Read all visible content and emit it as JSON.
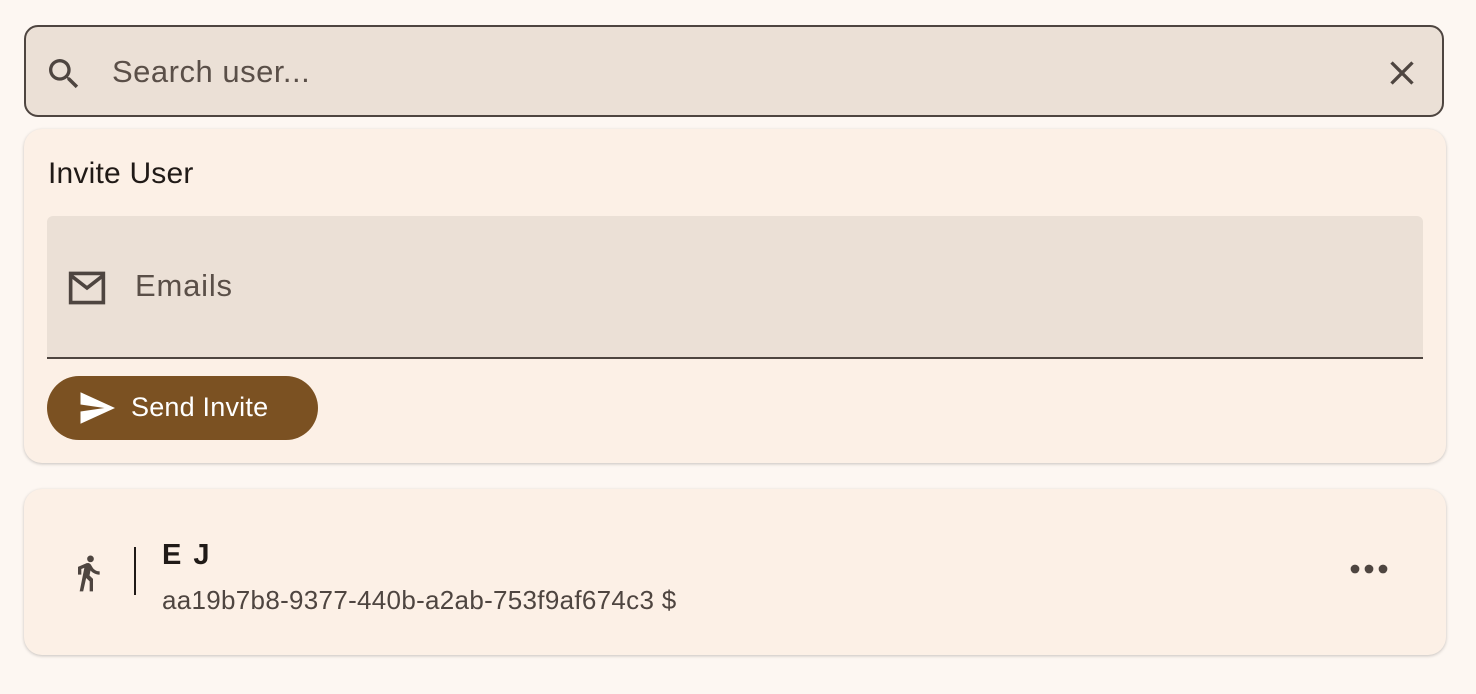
{
  "search": {
    "placeholder": "Search user...",
    "value": "",
    "icon": "search-icon",
    "clear_icon": "close-icon"
  },
  "invite": {
    "title": "Invite User",
    "email_placeholder": "Emails",
    "email_value": "",
    "email_icon": "mail-icon",
    "send_label": "Send Invite",
    "send_icon": "send-icon"
  },
  "users": [
    {
      "name": "E J",
      "id_line": "aa19b7b8-9377-440b-a2ab-753f9af674c3 $",
      "icon": "walking-person-icon",
      "menu_icon": "more-horizontal-icon"
    }
  ],
  "colors": {
    "background": "#fdf7f2",
    "surface": "#fcf0e6",
    "field": "#ebe0d6",
    "primary": "#7b5122",
    "outline": "#4e4540",
    "text": "#201a17"
  }
}
